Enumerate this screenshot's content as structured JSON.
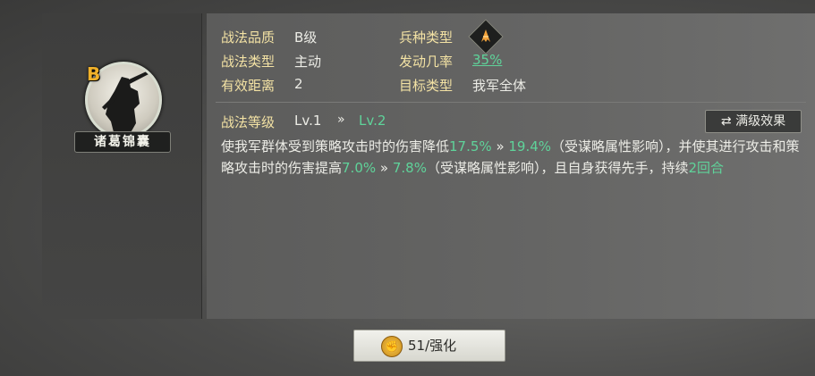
{
  "item": {
    "quality_letter": "B",
    "name": "诸葛锦囊"
  },
  "info": {
    "quality_label": "战法品质",
    "quality_value": "B级",
    "troop_label": "兵种类型",
    "troop_icon": "troop-type-icon",
    "type_label": "战法类型",
    "type_value": "主动",
    "rate_label": "发动几率",
    "rate_value": "35%",
    "range_label": "有效距离",
    "range_value": "2",
    "target_label": "目标类型",
    "target_value": "我军全体"
  },
  "level": {
    "label": "战法等级",
    "current": "Lv.1",
    "arrow": "»",
    "next": "Lv.2",
    "max_button": "满级效果",
    "max_icon": "⇄"
  },
  "description": {
    "p1": "使我军群体受到策略攻击时的伤害降低",
    "v1": "17.5%",
    "a1": " » ",
    "v2": "19.4%",
    "p2": "（受谋略属性影响），并使其进行攻击和策略攻击时的伤害提高",
    "v3": "7.0%",
    "a2": " » ",
    "v4": "7.8%",
    "p3": "（受谋略属性影响），且自身获得先手，持续",
    "v5": "2回合"
  },
  "enhance": {
    "icon": "fist-icon",
    "label": "51/强化"
  }
}
